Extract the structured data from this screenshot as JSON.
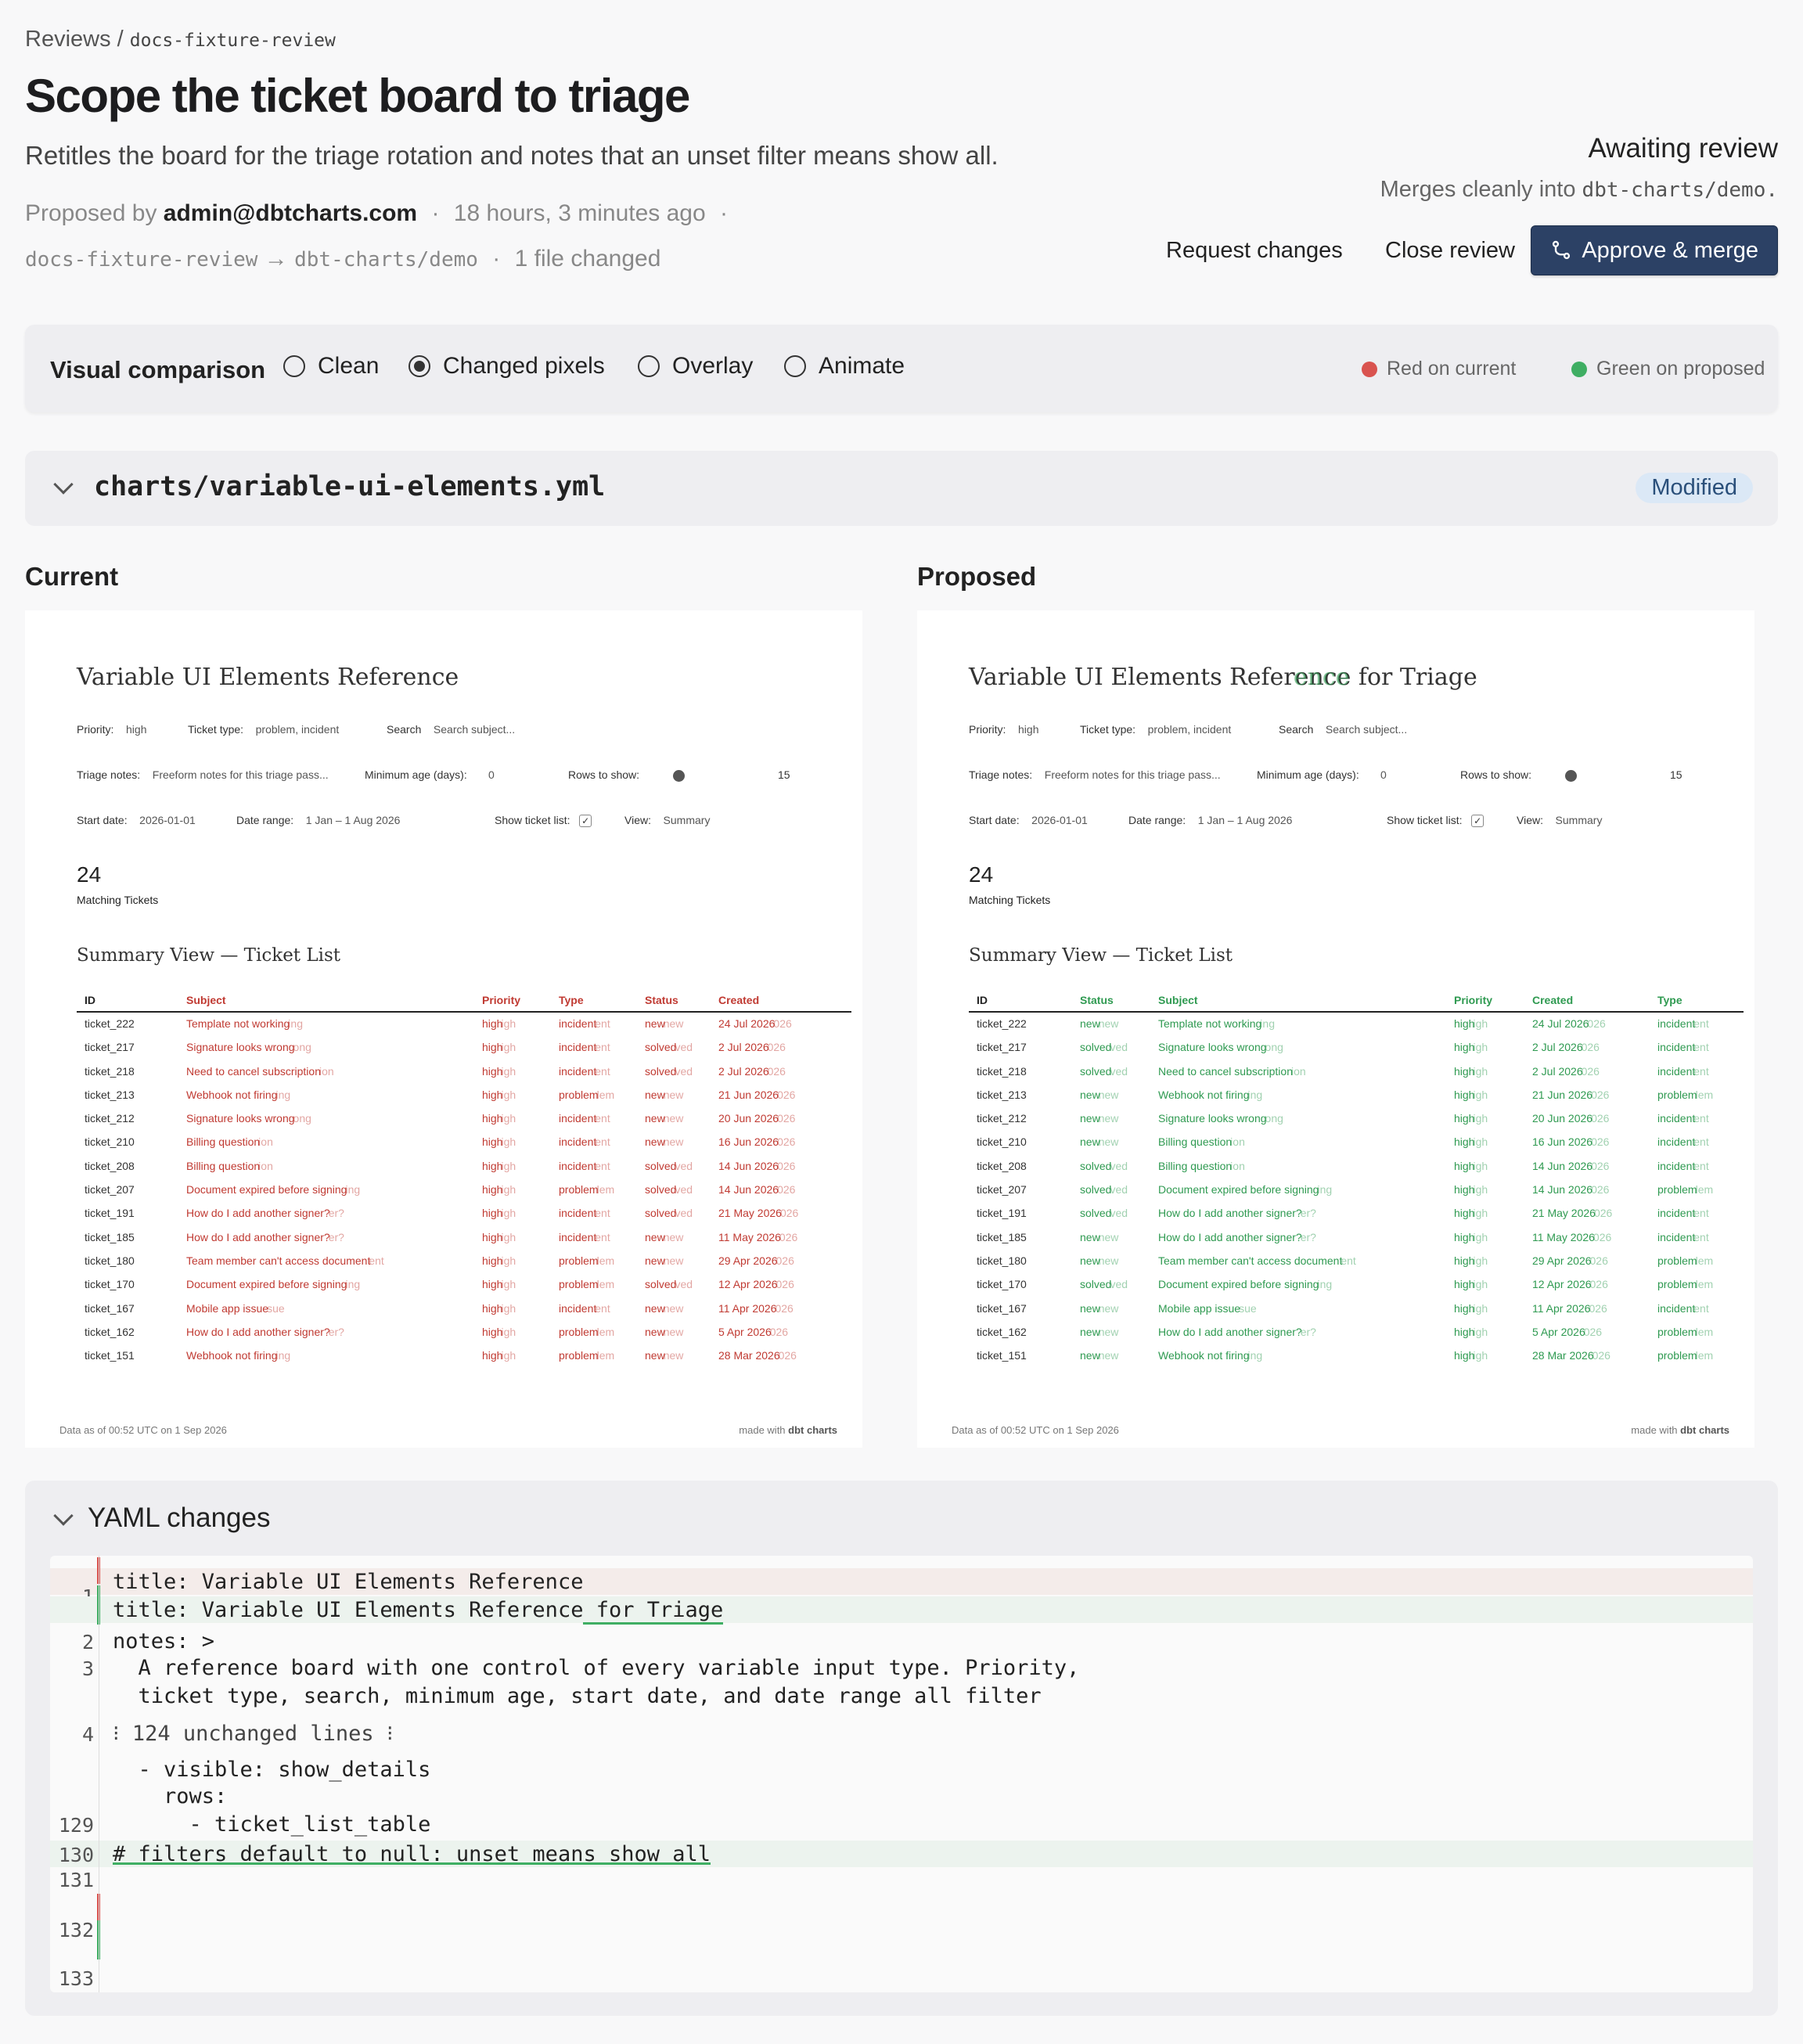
{
  "breadcrumb": {
    "section": "Reviews",
    "separator": "/",
    "branch": "docs-fixture-review"
  },
  "title": "Scope the ticket board to triage",
  "description": "Retitles the board for the triage rotation and notes that an unset filter means show all.",
  "meta": {
    "proposed_by_label": "Proposed by",
    "author": "admin@dbtcharts.com",
    "dot": "·",
    "time_ago": "18 hours, 3 minutes ago",
    "source_branch": "docs-fixture-review",
    "arrow": "→",
    "target_branch": "dbt-charts/demo",
    "files_changed": "1 file changed"
  },
  "review_status": {
    "label": "Awaiting review",
    "merges_prefix": "Merges cleanly into",
    "merges_target": "dbt-charts/demo."
  },
  "actions": {
    "request_changes": "Request changes",
    "close_review": "Close review",
    "approve": "Approve & merge"
  },
  "comparison": {
    "label": "Visual comparison",
    "modes": [
      "Clean",
      "Changed pixels",
      "Overlay",
      "Animate"
    ],
    "selected_index": 1,
    "legend_current": "Red on current",
    "legend_proposed": "Green on proposed",
    "red_color": "#d9534f",
    "green_color": "#3fae63"
  },
  "file": {
    "path": "charts/variable-ui-elements.yml",
    "badge": "Modified"
  },
  "panels": {
    "current": "Current",
    "proposed": "Proposed"
  },
  "chart": {
    "title_current": "Variable UI Elements Reference",
    "title_proposed_base": "Variable UI Elements Refer",
    "title_proposed_overlap": "ence",
    "title_proposed_added": "for Triage",
    "filters": {
      "priority_label": "Priority:",
      "priority_value": "high",
      "ticket_type_label": "Ticket type:",
      "ticket_type_value": "problem, incident",
      "search_label": "Search",
      "search_placeholder": "Search subject...",
      "triage_label": "Triage notes:",
      "triage_value": "Freeform notes for this triage pass...",
      "min_age_label": "Minimum age (days):",
      "min_age_value": "0",
      "rows_label": "Rows to show:",
      "rows_value": "15",
      "start_label": "Start date:",
      "start_value": "2026-01-01",
      "range_label": "Date range:",
      "range_value": "1 Jan – 1 Aug 2026",
      "show_list_label": "Show ticket list:",
      "view_label": "View:",
      "view_value": "Summary"
    },
    "metric_value": "24",
    "metric_label": "Matching Tickets",
    "section_title": "Summary View — Ticket List",
    "footer_left": "Data as of 00:52 UTC on 1 Sep 2026",
    "footer_right_prefix": "made with",
    "footer_right_brand": "dbt charts",
    "columns_current": [
      "ID",
      "Subject",
      "Priority",
      "Type",
      "Status",
      "Created"
    ],
    "columns_proposed": [
      "ID",
      "Status",
      "Subject",
      "Priority",
      "Created",
      "Type"
    ],
    "rows": [
      [
        "ticket_222",
        "Template not working",
        "high",
        "incident",
        "new",
        "24 Jul 2026"
      ],
      [
        "ticket_217",
        "Signature looks wrong",
        "high",
        "incident",
        "solved",
        "2 Jul 2026"
      ],
      [
        "ticket_218",
        "Need to cancel subscription",
        "high",
        "incident",
        "solved",
        "2 Jul 2026"
      ],
      [
        "ticket_213",
        "Webhook not firing",
        "high",
        "problem",
        "new",
        "21 Jun 2026"
      ],
      [
        "ticket_212",
        "Signature looks wrong",
        "high",
        "incident",
        "new",
        "20 Jun 2026"
      ],
      [
        "ticket_210",
        "Billing question",
        "high",
        "incident",
        "new",
        "16 Jun 2026"
      ],
      [
        "ticket_208",
        "Billing question",
        "high",
        "incident",
        "solved",
        "14 Jun 2026"
      ],
      [
        "ticket_207",
        "Document expired before signing",
        "high",
        "problem",
        "solved",
        "14 Jun 2026"
      ],
      [
        "ticket_191",
        "How do I add another signer?",
        "high",
        "incident",
        "solved",
        "21 May 2026"
      ],
      [
        "ticket_185",
        "How do I add another signer?",
        "high",
        "incident",
        "new",
        "11 May 2026"
      ],
      [
        "ticket_180",
        "Team member can't access document",
        "high",
        "problem",
        "new",
        "29 Apr 2026"
      ],
      [
        "ticket_170",
        "Document expired before signing",
        "high",
        "problem",
        "solved",
        "12 Apr 2026"
      ],
      [
        "ticket_167",
        "Mobile app issue",
        "high",
        "incident",
        "new",
        "11 Apr 2026"
      ],
      [
        "ticket_162",
        "How do I add another signer?",
        "high",
        "problem",
        "new",
        "5 Apr 2026"
      ],
      [
        "ticket_151",
        "Webhook not firing",
        "high",
        "problem",
        "new",
        "28 Mar 2026"
      ]
    ]
  },
  "yaml": {
    "heading": "YAML changes",
    "lines": [
      {
        "num": "1",
        "text": "title: Variable UI Elements Reference",
        "kind": "removed"
      },
      {
        "num": "",
        "text": "title: Variable UI Elements Reference",
        "added_suffix": " for Triage",
        "kind": "added"
      },
      {
        "num": "2",
        "text": "notes: >",
        "kind": "context"
      },
      {
        "num": "3",
        "text": "  A reference board with one control of every variable input type. Priority,",
        "kind": "context"
      },
      {
        "num": "",
        "text": "  ticket type, search, minimum age, start date, and date range all filter",
        "kind": "context"
      },
      {
        "num": "4",
        "text": "⁝ 124 unchanged lines ⁝",
        "kind": "fold"
      },
      {
        "num": "",
        "text": "  - visible: show_details",
        "kind": "context"
      },
      {
        "num": "",
        "text": "    rows:",
        "kind": "context"
      },
      {
        "num": "129",
        "text": "      - ticket_list_table",
        "kind": "context"
      },
      {
        "num": "130",
        "text": "# filters default to null: unset means show all",
        "kind": "added"
      },
      {
        "num": "131",
        "text": "",
        "kind": "context"
      },
      {
        "num": "132",
        "text": "",
        "kind": "changed"
      },
      {
        "num": "133",
        "text": "",
        "kind": "context"
      }
    ]
  }
}
